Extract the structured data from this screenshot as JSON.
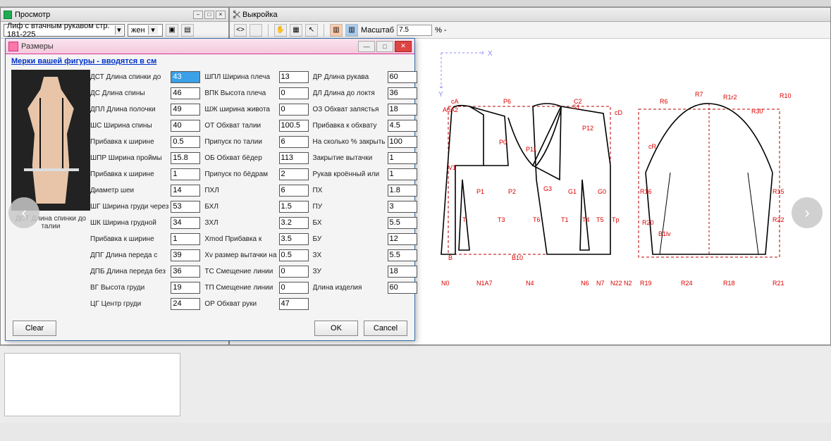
{
  "preview_panel": {
    "title": "Просмотр",
    "model_combo": "Лиф с втачным рукавом стр. 181-225",
    "gender_combo": "жен"
  },
  "pattern_panel": {
    "title": "Выкройка",
    "scale_label": "Масштаб",
    "scale_value": "7.5",
    "scale_suffix": "% -"
  },
  "dialog": {
    "title": "Размеры",
    "link": "Мерки вашей фигуры - вводятся в см",
    "img_caption": "ДСТ Длина спинки до талии",
    "col1": [
      {
        "l": "ДСТ Длина спинки до",
        "v": "43",
        "hl": true
      },
      {
        "l": "ДС Длина спины",
        "v": "46"
      },
      {
        "l": "ДПЛ Длина полочки",
        "v": "49"
      },
      {
        "l": "ШС Ширина спины",
        "v": "40"
      },
      {
        "l": "Прибавка к ширине",
        "v": "0.5"
      },
      {
        "l": "ШПР Ширина проймы",
        "v": "15.8"
      },
      {
        "l": "Прибавка к ширине",
        "v": "1"
      },
      {
        "l": "Диаметр шеи",
        "v": "14"
      },
      {
        "l": "ШГ Ширина груди через",
        "v": "53"
      },
      {
        "l": "ШК Ширина грудной",
        "v": "34"
      },
      {
        "l": "Прибавка к ширине",
        "v": "1"
      },
      {
        "l": "ДПГ Длина переда с",
        "v": "39"
      },
      {
        "l": "ДПБ Длина переда без",
        "v": "36"
      },
      {
        "l": "ВГ Высота груди",
        "v": "19"
      },
      {
        "l": "ЦГ Центр груди",
        "v": "24"
      }
    ],
    "col2": [
      {
        "l": "ШПЛ Ширина плеча",
        "v": "13"
      },
      {
        "l": "ВПК Высота плеча",
        "v": "0"
      },
      {
        "l": "ШЖ ширина живота",
        "v": "0"
      },
      {
        "l": "ОТ Обхват талии",
        "v": "100.5"
      },
      {
        "l": "Припуск по талии",
        "v": "6"
      },
      {
        "l": "ОБ Обхват бёдер",
        "v": "113"
      },
      {
        "l": "Припуск по бёдрам",
        "v": "2"
      },
      {
        "l": "ПХЛ",
        "v": "6"
      },
      {
        "l": "БХЛ",
        "v": "1.5"
      },
      {
        "l": "ЗХЛ",
        "v": "3.2"
      },
      {
        "l": "Xmod Прибавка к",
        "v": "3.5"
      },
      {
        "l": "Xv размер вытачки на",
        "v": "0.5"
      },
      {
        "l": "ТС Смещение линии",
        "v": "0"
      },
      {
        "l": "ТП Смещение линии",
        "v": "0"
      },
      {
        "l": "ОР Обхват руки",
        "v": "47"
      }
    ],
    "col3": [
      {
        "l": "ДР Длина рукава",
        "v": "60"
      },
      {
        "l": "ДЛ Длина до локтя",
        "v": "36"
      },
      {
        "l": "ОЗ Обхват запястья",
        "v": "18"
      },
      {
        "l": "Прибавка к обхвату",
        "v": "4.5"
      },
      {
        "l": "На сколько % закрыть",
        "v": "100"
      },
      {
        "l": "Закрытие вытачки",
        "v": "1"
      },
      {
        "l": "Рукав кроённый или",
        "v": "1"
      },
      {
        "l": "ПХ",
        "v": "1.8"
      },
      {
        "l": "ПУ",
        "v": "3"
      },
      {
        "l": "БХ",
        "v": "5.5"
      },
      {
        "l": "БУ",
        "v": "12"
      },
      {
        "l": "ЗХ",
        "v": "5.5"
      },
      {
        "l": "ЗУ",
        "v": "18"
      },
      {
        "l": "Длина изделия",
        "v": "60"
      }
    ],
    "clear_btn": "Clear",
    "ok_btn": "OK",
    "cancel_btn": "Cancel"
  },
  "pattern_labels": [
    "cA",
    "A0A2",
    "V1",
    "P1",
    "T",
    "B",
    "N0",
    "P6",
    "P0",
    "P11",
    "P2",
    "G3",
    "T1",
    "N4",
    "B10",
    "T3",
    "N6",
    "N1A7",
    "C2",
    "P12",
    "T4",
    "T5",
    "N7",
    "G1",
    "G0",
    "Tp",
    "N22",
    "N2",
    "R6",
    "R7",
    "R30",
    "cR",
    "R16",
    "R19",
    "R20",
    "R24",
    "R21",
    "R22",
    "R15",
    "R10",
    "R1",
    "cD",
    "B1lv",
    "R18",
    "S1"
  ]
}
